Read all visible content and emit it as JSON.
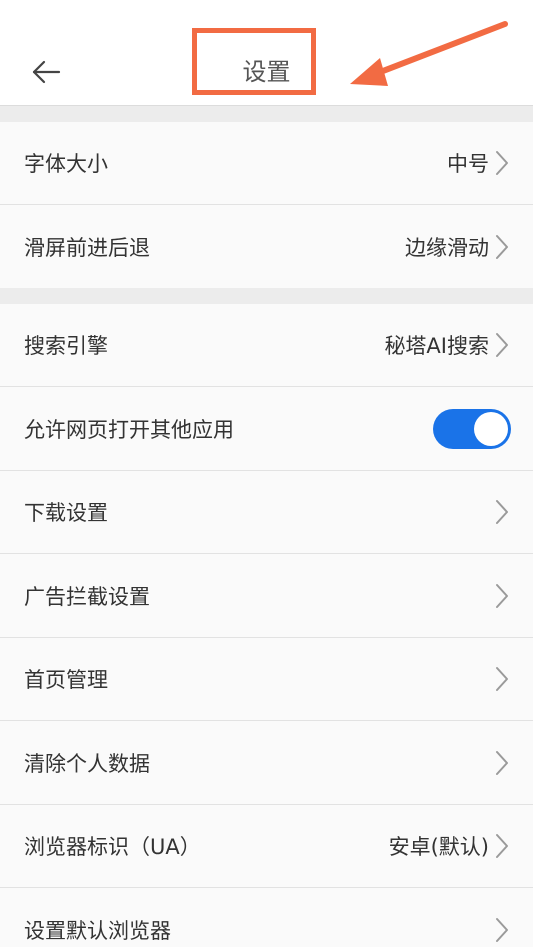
{
  "header": {
    "title": "设置",
    "back_icon": "arrow-left-icon"
  },
  "annotation": {
    "color": "#f26b43"
  },
  "groups": [
    {
      "items": [
        {
          "label": "字体大小",
          "value": "中号",
          "type": "chevron"
        },
        {
          "label": "滑屏前进后退",
          "value": "边缘滑动",
          "type": "chevron"
        }
      ]
    },
    {
      "items": [
        {
          "label": "搜索引擎",
          "value": "秘塔AI搜索",
          "type": "chevron"
        },
        {
          "label": "允许网页打开其他应用",
          "value": "",
          "type": "toggle",
          "toggle_on": true
        },
        {
          "label": "下载设置",
          "value": "",
          "type": "chevron"
        },
        {
          "label": "广告拦截设置",
          "value": "",
          "type": "chevron"
        },
        {
          "label": "首页管理",
          "value": "",
          "type": "chevron"
        },
        {
          "label": "清除个人数据",
          "value": "",
          "type": "chevron"
        },
        {
          "label": "浏览器标识（UA）",
          "value": "安卓(默认)",
          "type": "chevron"
        },
        {
          "label": "设置默认浏览器",
          "value": "",
          "type": "chevron"
        }
      ]
    }
  ],
  "colors": {
    "toggle_on": "#1a73e8",
    "text": "#333333",
    "chevron": "#9a9a9a"
  }
}
